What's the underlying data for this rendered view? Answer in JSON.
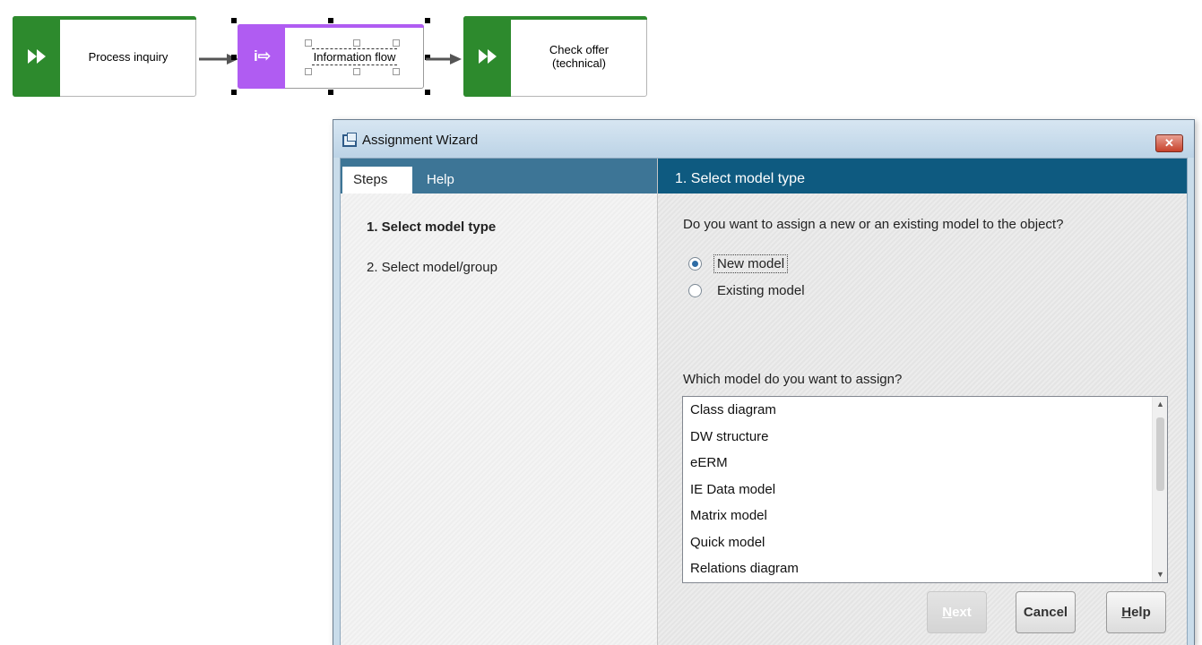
{
  "diagram": {
    "nodes": [
      {
        "label": "Process inquiry",
        "kind": "function",
        "color": "#2d8a2d",
        "icon": "fast-forward-icon"
      },
      {
        "label": "Information flow",
        "kind": "information-flow",
        "color": "#b05cf2",
        "icon": "info-flow-icon",
        "icon_text": "i⇨"
      },
      {
        "label": "Check offer\n(technical)",
        "kind": "function",
        "color": "#2d8a2d",
        "icon": "fast-forward-icon"
      }
    ]
  },
  "dialog": {
    "title": "Assignment Wizard",
    "close_label": "✕",
    "tabs": [
      {
        "label": "Steps",
        "active": true
      },
      {
        "label": "Help",
        "active": false
      }
    ],
    "steps": [
      {
        "label": "1. Select model type",
        "current": true
      },
      {
        "label": "2. Select model/group",
        "current": false
      }
    ],
    "panel_header": "1. Select model type",
    "question": "Do you want to assign a new or an existing model to the object?",
    "options": [
      {
        "label": "New model",
        "checked": true
      },
      {
        "label": "Existing model",
        "checked": false
      }
    ],
    "list_label": "Which model do you want to assign?",
    "models": [
      "Class diagram",
      "DW structure",
      "eERM",
      "IE Data model",
      "Matrix model",
      "Quick model",
      "Relations diagram"
    ],
    "buttons": {
      "next": {
        "first": "N",
        "rest": "ext",
        "enabled": false
      },
      "cancel": {
        "label": "Cancel"
      },
      "help": {
        "first": "H",
        "rest": "elp"
      }
    }
  }
}
